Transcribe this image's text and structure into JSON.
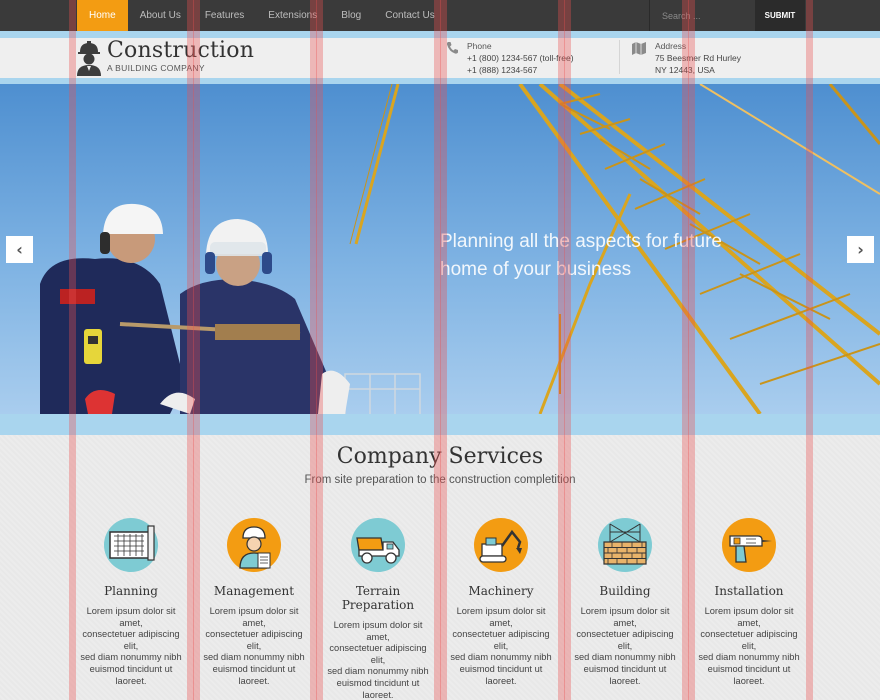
{
  "nav": {
    "items": [
      "Home",
      "About Us",
      "Features",
      "Extensions",
      "Blog",
      "Contact Us"
    ],
    "active_index": 0,
    "search_placeholder": "Search ...",
    "submit_label": "SUBMIT"
  },
  "header": {
    "brand": "Construction",
    "tagline": "A BUILDING COMPANY",
    "phone": {
      "title": "Phone",
      "lines": [
        "+1 (800) 1234-567 (toll-free)",
        "+1 (888) 1234-567"
      ]
    },
    "address": {
      "title": "Address",
      "lines": [
        "75 Beesmer Rd Hurley",
        "NY 12443, USA"
      ]
    }
  },
  "hero": {
    "caption_line1": "Planning all the aspects for future",
    "caption_line2": "home of your business",
    "prev_icon": "chevron-left-icon",
    "next_icon": "chevron-right-icon"
  },
  "services": {
    "title": "Company Services",
    "subtitle": "From site preparation to the construction completition",
    "items": [
      {
        "name": "Planning",
        "icon": "blueprint-icon",
        "color": "#7ecbd3",
        "desc": [
          "Lorem ipsum dolor sit amet,",
          "consectetuer adipiscing elit,",
          "sed diam nonummy nibh",
          "euismod tincidunt ut",
          "laoreet."
        ]
      },
      {
        "name": "Management",
        "icon": "engineer-icon",
        "color": "#f39c12",
        "desc": [
          "Lorem ipsum dolor sit amet,",
          "consectetuer adipiscing elit,",
          "sed diam nonummy nibh",
          "euismod tincidunt ut",
          "laoreet."
        ]
      },
      {
        "name": "Terrain Preparation",
        "icon": "dump-truck-icon",
        "color": "#7ecbd3",
        "desc": [
          "Lorem ipsum dolor sit amet,",
          "consectetuer adipiscing elit,",
          "sed diam nonummy nibh",
          "euismod tincidunt ut",
          "laoreet."
        ]
      },
      {
        "name": "Machinery",
        "icon": "excavator-icon",
        "color": "#f39c12",
        "desc": [
          "Lorem ipsum dolor sit amet,",
          "consectetuer adipiscing elit,",
          "sed diam nonummy nibh",
          "euismod tincidunt ut",
          "laoreet."
        ]
      },
      {
        "name": "Building",
        "icon": "brick-wall-icon",
        "color": "#7ecbd3",
        "desc": [
          "Lorem ipsum dolor sit amet,",
          "consectetuer adipiscing elit,",
          "sed diam nonummy nibh",
          "euismod tincidunt ut",
          "laoreet."
        ]
      },
      {
        "name": "Installation",
        "icon": "drill-icon",
        "color": "#f39c12",
        "desc": [
          "Lorem ipsum dolor sit amet,",
          "consectetuer adipiscing elit,",
          "sed diam nonummy nibh",
          "euismod tincidunt ut",
          "laoreet."
        ]
      }
    ]
  },
  "colors": {
    "accent": "#f39c12",
    "nav_bg": "#3a3a3a",
    "band": "#a9d5ee",
    "teal": "#7ecbd3"
  }
}
